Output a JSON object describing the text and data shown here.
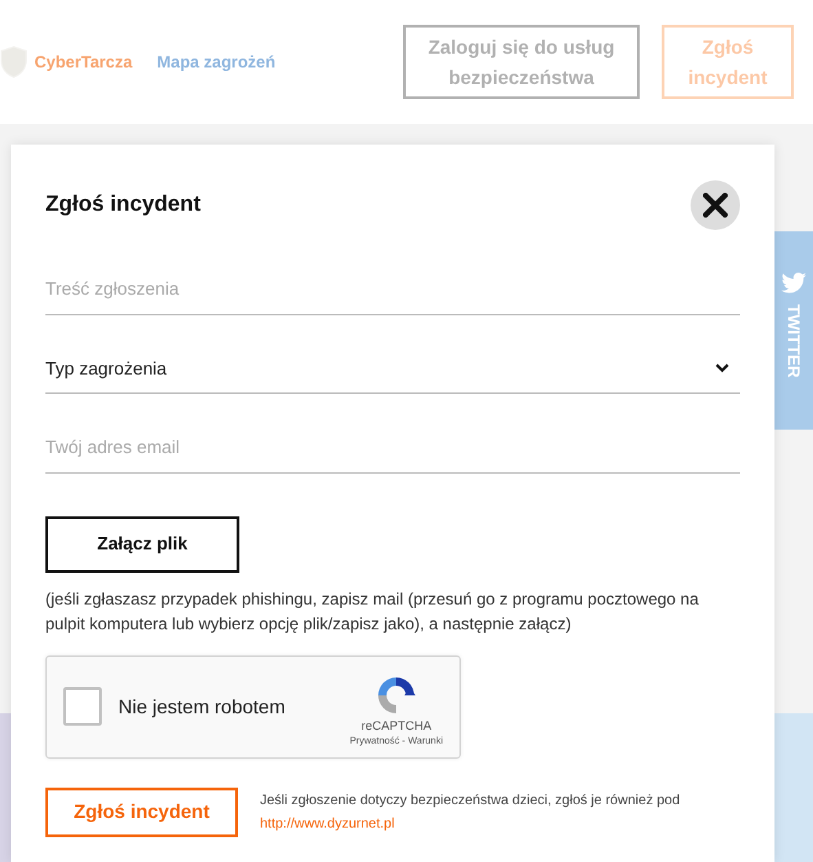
{
  "header": {
    "logo_text": "CyberTarcza",
    "nav_link": "Mapa zagrożeń",
    "buttons": [
      {
        "label": "Zaloguj się do usług bezpieczeństwa",
        "kind": "outline"
      },
      {
        "label": "Zgłoś incydent",
        "kind": "accent"
      }
    ]
  },
  "side_tab": {
    "label": "TWITTER"
  },
  "modal": {
    "title": "Zgłoś incydent",
    "fields": [
      {
        "kind": "text",
        "placeholder": "Treść zgłoszenia"
      },
      {
        "kind": "select",
        "value": "Typ zagrożenia"
      },
      {
        "kind": "text",
        "placeholder": "Twój adres email"
      }
    ],
    "attach_button": "Załącz plik",
    "note": "(jeśli zgłaszasz przypadek phishingu, zapisz mail (przesuń go z programu pocztowego na pulpit komputera lub wybierz opcję plik/zapisz jako), a następnie załącz)",
    "captcha": {
      "label": "Nie jestem robotem",
      "checked": false,
      "brand": "reCAPTCHA",
      "links": "Prywatność - Warunki"
    },
    "submit_button": "Zgłoś incydent",
    "footnote": {
      "text": "Jeśli zgłoszenie dotyczy bezpieczeństwa dzieci, zgłoś je również pod ",
      "link": "http://www.dyzurnet.pl"
    }
  }
}
